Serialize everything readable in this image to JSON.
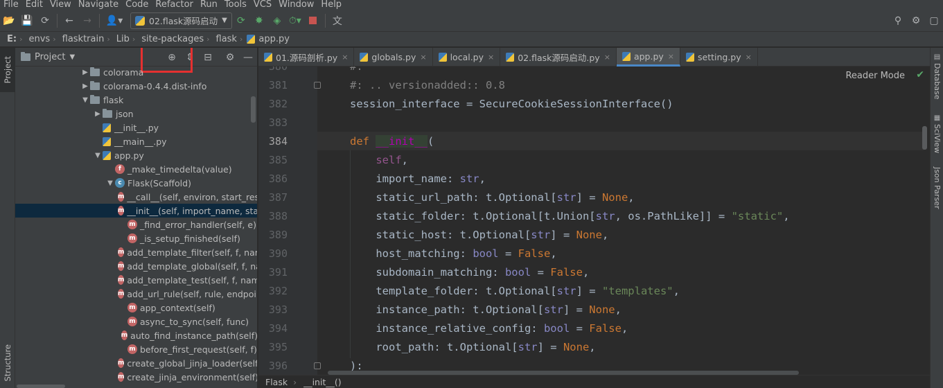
{
  "menu": [
    "File",
    "Edit",
    "View",
    "Navigate",
    "Code",
    "Refactor",
    "Run",
    "Tools",
    "VCS",
    "Window",
    "Help"
  ],
  "toolbar": {
    "run_config": "02.flask源码启动",
    "icons": [
      "folder-open-icon",
      "save-icon",
      "sync-icon",
      "back-icon",
      "forward-icon",
      "user-icon",
      "run-icon",
      "debug-icon",
      "coverage-icon",
      "profile-icon",
      "stop-icon",
      "translate-icon",
      "search-icon",
      "settings-icon",
      "expand-icon"
    ]
  },
  "breadcrumb": [
    "E:",
    "envs",
    "flasktrain",
    "Lib",
    "site-packages",
    "flask",
    "app.py"
  ],
  "left_stripe": {
    "project": "Project",
    "structure": "Structure"
  },
  "project_panel": {
    "title": "Project",
    "tree": [
      {
        "label": "colorama",
        "kind": "folder",
        "arrow": "▶",
        "indent": 0
      },
      {
        "label": "colorama-0.4.4.dist-info",
        "kind": "folder",
        "arrow": "▶",
        "indent": 0
      },
      {
        "label": "flask",
        "kind": "folder",
        "arrow": "▼",
        "indent": 0
      },
      {
        "label": "json",
        "kind": "folder",
        "arrow": "▶",
        "indent": 1
      },
      {
        "label": "__init__.py",
        "kind": "py",
        "arrow": "",
        "indent": 1
      },
      {
        "label": "__main__.py",
        "kind": "py",
        "arrow": "",
        "indent": 1
      },
      {
        "label": "app.py",
        "kind": "py",
        "arrow": "▼",
        "indent": 1
      },
      {
        "label": "_make_timedelta(value)",
        "kind": "f",
        "arrow": "",
        "indent": 2
      },
      {
        "label": "Flask(Scaffold)",
        "kind": "c",
        "arrow": "▼",
        "indent": 2
      },
      {
        "label": "__call__(self, environ, start_response)",
        "kind": "m",
        "arrow": "",
        "indent": 3
      },
      {
        "label": "__init__(self, import_name, static_url_path)",
        "kind": "m",
        "arrow": "",
        "indent": 3,
        "selected": true
      },
      {
        "label": "_find_error_handler(self, e)",
        "kind": "m",
        "arrow": "",
        "indent": 3
      },
      {
        "label": "_is_setup_finished(self)",
        "kind": "m",
        "arrow": "",
        "indent": 3
      },
      {
        "label": "add_template_filter(self, f, name)",
        "kind": "m",
        "arrow": "",
        "indent": 3
      },
      {
        "label": "add_template_global(self, f, name)",
        "kind": "m",
        "arrow": "",
        "indent": 3
      },
      {
        "label": "add_template_test(self, f, name)",
        "kind": "m",
        "arrow": "",
        "indent": 3
      },
      {
        "label": "add_url_rule(self, rule, endpoint)",
        "kind": "m",
        "arrow": "",
        "indent": 3
      },
      {
        "label": "app_context(self)",
        "kind": "m",
        "arrow": "",
        "indent": 3
      },
      {
        "label": "async_to_sync(self, func)",
        "kind": "m",
        "arrow": "",
        "indent": 3
      },
      {
        "label": "auto_find_instance_path(self)",
        "kind": "m",
        "arrow": "",
        "indent": 3
      },
      {
        "label": "before_first_request(self, f)",
        "kind": "m",
        "arrow": "",
        "indent": 3
      },
      {
        "label": "create_global_jinja_loader(self)",
        "kind": "m",
        "arrow": "",
        "indent": 3
      },
      {
        "label": "create_jinja_environment(self)",
        "kind": "m",
        "arrow": "",
        "indent": 3
      }
    ]
  },
  "tabs": [
    {
      "label": "01.源码剖析.py",
      "active": false
    },
    {
      "label": "globals.py",
      "active": false
    },
    {
      "label": "local.py",
      "active": false
    },
    {
      "label": "02.flask源码启动.py",
      "active": false
    },
    {
      "label": "app.py",
      "active": true
    },
    {
      "label": "setting.py",
      "active": false
    }
  ],
  "editor": {
    "reader_mode": "Reader Mode",
    "current_line": "384",
    "lines": [
      {
        "n": "380",
        "html": "<span class=\"cmt\">#.</span>"
      },
      {
        "n": "381",
        "html": "<span class=\"cmt\">#: .. versionadded:: 0.8</span>"
      },
      {
        "n": "382",
        "html": "session_interface = SecureCookieSessionInterface()"
      },
      {
        "n": "383",
        "html": ""
      },
      {
        "n": "384",
        "html": "<span class=\"kw\">def</span> <span class=\"dunder\">__init__</span>("
      },
      {
        "n": "385",
        "html": "    <span class=\"self\">self</span>,"
      },
      {
        "n": "386",
        "html": "    import_name: <span class=\"bi\">str</span>,"
      },
      {
        "n": "387",
        "html": "    static_url_path: t.Optional[<span class=\"bi\">str</span>] = <span class=\"kw\">None</span>,"
      },
      {
        "n": "388",
        "html": "    static_folder: t.Optional[t.Union[<span class=\"bi\">str</span>, os.PathLike]] = <span class=\"str\">\"static\"</span>,"
      },
      {
        "n": "389",
        "html": "    static_host: t.Optional[<span class=\"bi\">str</span>] = <span class=\"kw\">None</span>,"
      },
      {
        "n": "390",
        "html": "    host_matching: <span class=\"bi\">bool</span> = <span class=\"kw\">False</span>,"
      },
      {
        "n": "391",
        "html": "    subdomain_matching: <span class=\"bi\">bool</span> = <span class=\"kw\">False</span>,"
      },
      {
        "n": "392",
        "html": "    template_folder: t.Optional[<span class=\"bi\">str</span>] = <span class=\"str\">\"templates\"</span>,"
      },
      {
        "n": "393",
        "html": "    instance_path: t.Optional[<span class=\"bi\">str</span>] = <span class=\"kw\">None</span>,"
      },
      {
        "n": "394",
        "html": "    instance_relative_config: <span class=\"bi\">bool</span> = <span class=\"kw\">False</span>,"
      },
      {
        "n": "395",
        "html": "    root_path: t.Optional[<span class=\"bi\">str</span>] = <span class=\"kw\">None</span>,"
      },
      {
        "n": "396",
        "html": "):"
      }
    ]
  },
  "editor_breadcrumb": [
    "Flask",
    "__init__()"
  ],
  "right_stripe": [
    "Database",
    "SciView",
    "Json Parser"
  ],
  "colors": {
    "accent": "#4a88c7",
    "highlight_box": "#e53030",
    "selection": "#0d293e"
  }
}
